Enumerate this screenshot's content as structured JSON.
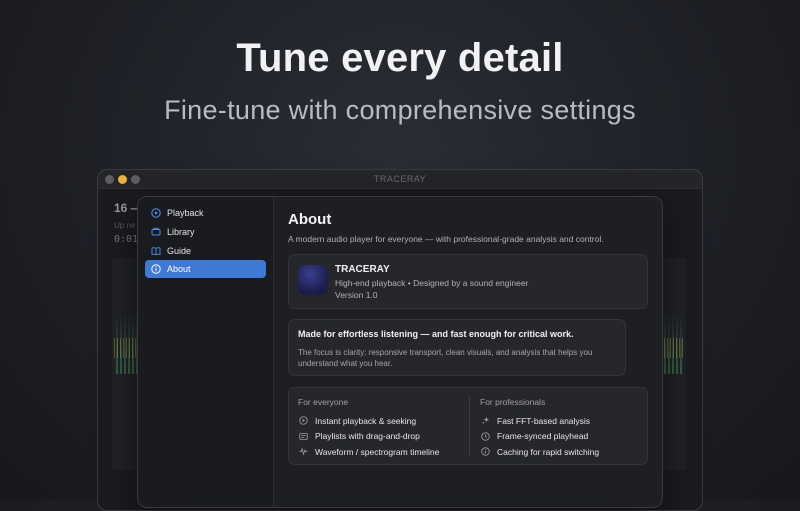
{
  "hero": {
    "title": "Tune every detail",
    "subtitle": "Fine-tune with comprehensive settings"
  },
  "background_window": {
    "title": "TRACERAY",
    "count_text": "16 —",
    "subtext": "Up ne",
    "time": "0:01"
  },
  "sidebar": {
    "items": [
      {
        "label": "Playback",
        "icon": "play-circle-icon",
        "active": false
      },
      {
        "label": "Library",
        "icon": "library-icon",
        "active": false
      },
      {
        "label": "Guide",
        "icon": "book-icon",
        "active": false
      },
      {
        "label": "About",
        "icon": "info-icon",
        "active": true
      }
    ]
  },
  "about": {
    "title": "About",
    "description": "A modern audio player for everyone — with professional-grade analysis and control.",
    "app_name": "TRACERAY",
    "tagline": "High-end playback • Designed by a sound engineer",
    "version": "Version 1.0",
    "pitch_headline": "Made for effortless listening — and fast enough for critical work.",
    "pitch_body": "The focus is clarity: responsive transport, clean visuals, and analysis that helps you understand what you hear.",
    "everyone": {
      "heading": "For everyone",
      "items": [
        {
          "label": "Instant playback & seeking",
          "icon": "play-circle-icon"
        },
        {
          "label": "Playlists with drag-and-drop",
          "icon": "playlist-icon"
        },
        {
          "label": "Waveform / spectrogram timeline",
          "icon": "waveform-icon"
        }
      ]
    },
    "professionals": {
      "heading": "For professionals",
      "items": [
        {
          "label": "Fast FFT-based analysis",
          "icon": "sparkles-icon"
        },
        {
          "label": "Frame-synced playhead",
          "icon": "clock-icon"
        },
        {
          "label": "Caching for rapid switching",
          "icon": "info-icon"
        }
      ]
    }
  },
  "colors": {
    "accent": "#3f7ad6",
    "background": "#1d1f25",
    "panel": "#1e1f23",
    "card": "#26272b"
  }
}
